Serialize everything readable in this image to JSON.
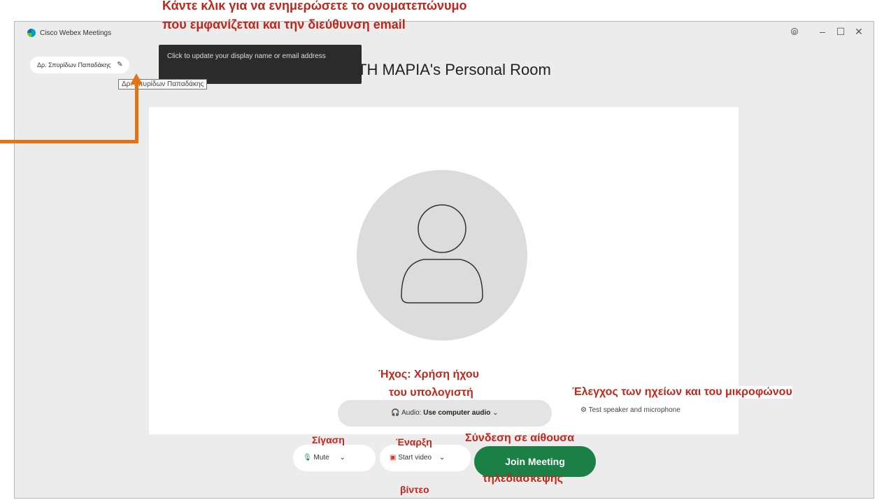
{
  "window": {
    "title": "Cisco Webex Meetings",
    "controls": {
      "help": "⦾",
      "minimize": "–",
      "maximize": "☐",
      "close": "✕"
    }
  },
  "user": {
    "display_name": "Δρ. Σπυρίδων Παπαδάκης"
  },
  "room": {
    "title": "TH MAPIA's Personal Room"
  },
  "tooltip": {
    "update_name": "Click to update your display name or email address",
    "name_hover": "Δρ. Σπυρίδων Παπαδάκης"
  },
  "audio": {
    "prefix": "Audio: ",
    "value": "Use computer audio"
  },
  "test": {
    "label": "Test speaker and microphone"
  },
  "controls": {
    "mute": "Mute",
    "start_video": "Start video",
    "join": "Join Meeting"
  },
  "annotations": {
    "top_line1": "Κάντε κλικ για να ενημερώσετε το ονοματεπώνυμο",
    "top_line2": "που εμφανίζεται και την διεύθυνση email",
    "audio_line1": "Ήχος: Χρήση ήχου",
    "audio_line2": "του υπολογιστή",
    "test": "Έλεγχος των ηχείων και του μικροφώνου",
    "mute": "Σίγαση",
    "video_line1": "Έναρξη",
    "video_line2": "βίντεο",
    "join_line1": "Σύνδεση σε αίθουσα",
    "join_line2": "τηλεδιάσκεψης"
  },
  "colors": {
    "annotation": "#c0271c",
    "arrow": "#e37313",
    "join_button": "#1a8045"
  }
}
